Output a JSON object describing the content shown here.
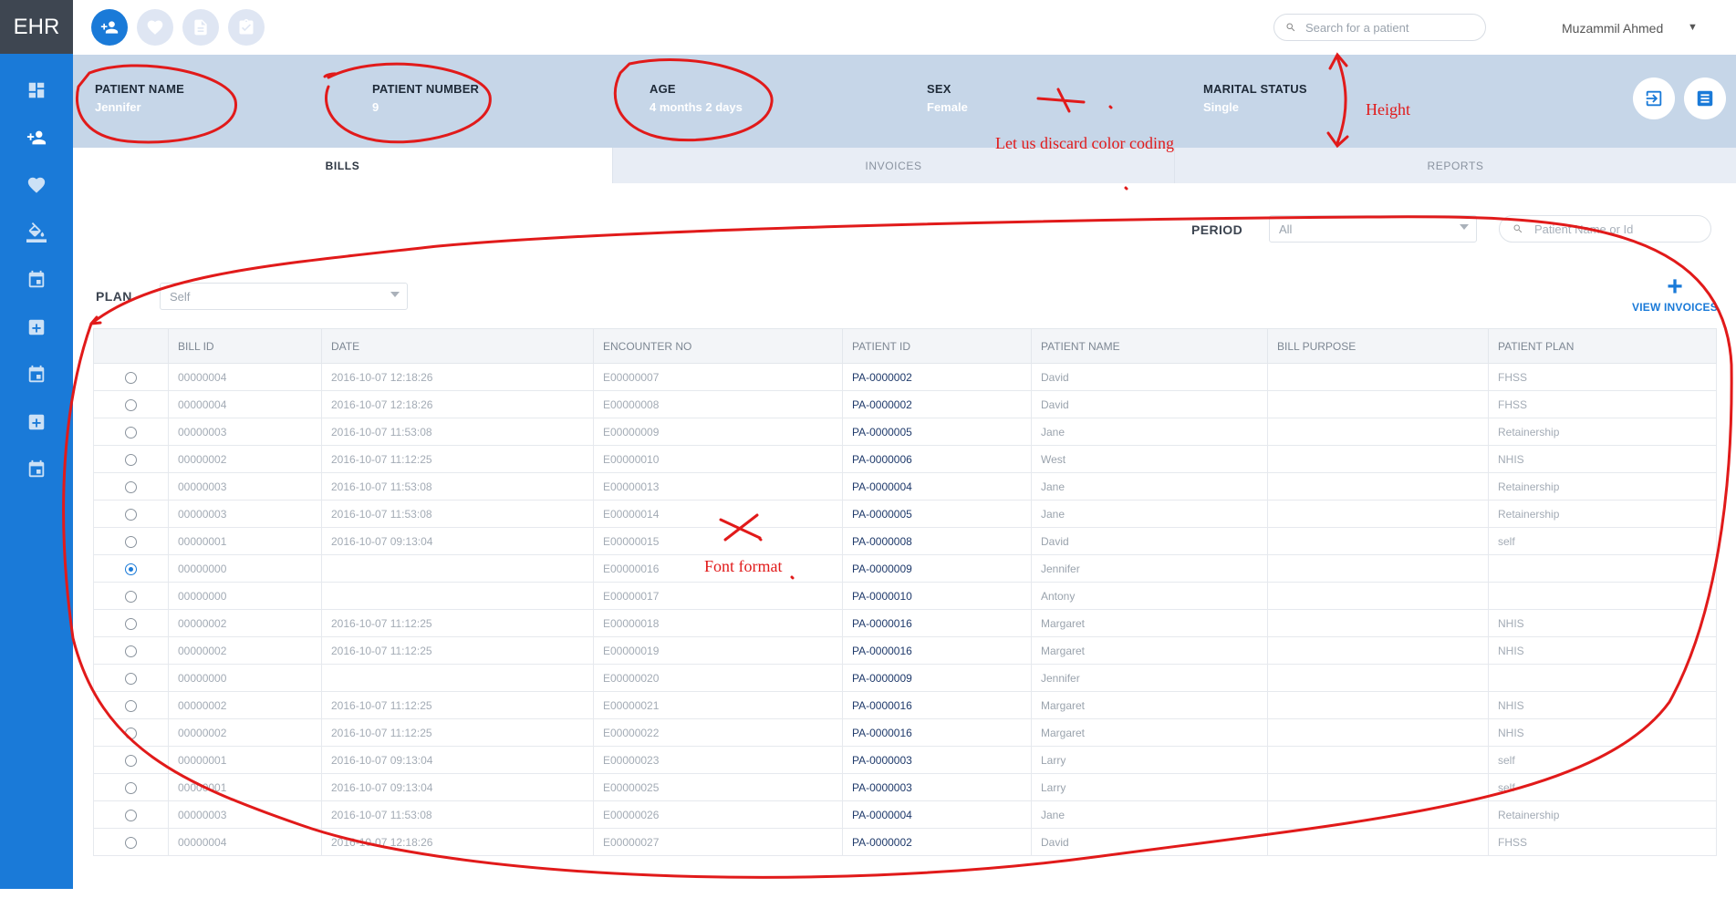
{
  "app": {
    "logo": "EHR"
  },
  "sidebar": {
    "icons": [
      {
        "name": "dashboard-icon",
        "active": false
      },
      {
        "name": "add-patient-icon",
        "active": true
      },
      {
        "name": "heart-icon",
        "active": false
      },
      {
        "name": "paint-bucket-icon",
        "active": false
      },
      {
        "name": "calendar-icon",
        "active": false
      },
      {
        "name": "hospital-add-icon",
        "active": false
      },
      {
        "name": "calendar-icon",
        "active": false
      },
      {
        "name": "hospital-add-icon",
        "active": false
      },
      {
        "name": "calendar-icon",
        "active": false
      }
    ]
  },
  "topbar": {
    "search_placeholder": "Search for a patient",
    "user_name": "Muzammil Ahmed"
  },
  "patient": {
    "name_label": "PATIENT NAME",
    "name": "Jennifer",
    "number_label": "PATIENT NUMBER",
    "number": "9",
    "age_label": "AGE",
    "age": "4 months 2 days",
    "sex_label": "SEX",
    "sex": "Female",
    "marital_label": "MARITAL STATUS",
    "marital": "Single"
  },
  "tabs": [
    {
      "label": "BILLS",
      "active": true
    },
    {
      "label": "INVOICES",
      "active": false
    },
    {
      "label": "REPORTS",
      "active": false
    }
  ],
  "filters": {
    "period_label": "PERIOD",
    "period_value": "All",
    "patient_search_placeholder": "Patient Name or Id",
    "plan_label": "PLAN",
    "plan_value": "Self",
    "view_invoices_label": "VIEW INVOICES",
    "add_symbol": "+"
  },
  "table": {
    "columns": [
      "BILL ID",
      "DATE",
      "ENCOUNTER NO",
      "PATIENT ID",
      "PATIENT NAME",
      "BILL PURPOSE",
      "PATIENT PLAN"
    ],
    "rows": [
      {
        "bill_id": "00000004",
        "date": "2016-10-07 12:18:26",
        "encounter": "E00000007",
        "patient_id": "PA-0000002",
        "patient_name": "David",
        "purpose": "",
        "plan": "FHSS",
        "selected": false
      },
      {
        "bill_id": "00000004",
        "date": "2016-10-07 12:18:26",
        "encounter": "E00000008",
        "patient_id": "PA-0000002",
        "patient_name": "David",
        "purpose": "",
        "plan": "FHSS",
        "selected": false
      },
      {
        "bill_id": "00000003",
        "date": "2016-10-07 11:53:08",
        "encounter": "E00000009",
        "patient_id": "PA-0000005",
        "patient_name": "Jane",
        "purpose": "",
        "plan": "Retainership",
        "selected": false
      },
      {
        "bill_id": "00000002",
        "date": "2016-10-07 11:12:25",
        "encounter": "E00000010",
        "patient_id": "PA-0000006",
        "patient_name": "West",
        "purpose": "",
        "plan": "NHIS",
        "selected": false
      },
      {
        "bill_id": "00000003",
        "date": "2016-10-07 11:53:08",
        "encounter": "E00000013",
        "patient_id": "PA-0000004",
        "patient_name": "Jane",
        "purpose": "",
        "plan": "Retainership",
        "selected": false
      },
      {
        "bill_id": "00000003",
        "date": "2016-10-07 11:53:08",
        "encounter": "E00000014",
        "patient_id": "PA-0000005",
        "patient_name": "Jane",
        "purpose": "",
        "plan": "Retainership",
        "selected": false
      },
      {
        "bill_id": "00000001",
        "date": "2016-10-07 09:13:04",
        "encounter": "E00000015",
        "patient_id": "PA-0000008",
        "patient_name": "David",
        "purpose": "",
        "plan": "self",
        "selected": false
      },
      {
        "bill_id": "00000000",
        "date": "",
        "encounter": "E00000016",
        "patient_id": "PA-0000009",
        "patient_name": "Jennifer",
        "purpose": "",
        "plan": "",
        "selected": true
      },
      {
        "bill_id": "00000000",
        "date": "",
        "encounter": "E00000017",
        "patient_id": "PA-0000010",
        "patient_name": "Antony",
        "purpose": "",
        "plan": "",
        "selected": false
      },
      {
        "bill_id": "00000002",
        "date": "2016-10-07 11:12:25",
        "encounter": "E00000018",
        "patient_id": "PA-0000016",
        "patient_name": "Margaret",
        "purpose": "",
        "plan": "NHIS",
        "selected": false
      },
      {
        "bill_id": "00000002",
        "date": "2016-10-07 11:12:25",
        "encounter": "E00000019",
        "patient_id": "PA-0000016",
        "patient_name": "Margaret",
        "purpose": "",
        "plan": "NHIS",
        "selected": false
      },
      {
        "bill_id": "00000000",
        "date": "",
        "encounter": "E00000020",
        "patient_id": "PA-0000009",
        "patient_name": "Jennifer",
        "purpose": "",
        "plan": "",
        "selected": false
      },
      {
        "bill_id": "00000002",
        "date": "2016-10-07 11:12:25",
        "encounter": "E00000021",
        "patient_id": "PA-0000016",
        "patient_name": "Margaret",
        "purpose": "",
        "plan": "NHIS",
        "selected": false
      },
      {
        "bill_id": "00000002",
        "date": "2016-10-07 11:12:25",
        "encounter": "E00000022",
        "patient_id": "PA-0000016",
        "patient_name": "Margaret",
        "purpose": "",
        "plan": "NHIS",
        "selected": false
      },
      {
        "bill_id": "00000001",
        "date": "2016-10-07 09:13:04",
        "encounter": "E00000023",
        "patient_id": "PA-0000003",
        "patient_name": "Larry",
        "purpose": "",
        "plan": "self",
        "selected": false
      },
      {
        "bill_id": "00000001",
        "date": "2016-10-07 09:13:04",
        "encounter": "E00000025",
        "patient_id": "PA-0000003",
        "patient_name": "Larry",
        "purpose": "",
        "plan": "self",
        "selected": false
      },
      {
        "bill_id": "00000003",
        "date": "2016-10-07 11:53:08",
        "encounter": "E00000026",
        "patient_id": "PA-0000004",
        "patient_name": "Jane",
        "purpose": "",
        "plan": "Retainership",
        "selected": false
      },
      {
        "bill_id": "00000004",
        "date": "2016-10-07 12:18:26",
        "encounter": "E00000027",
        "patient_id": "PA-0000002",
        "patient_name": "David",
        "purpose": "",
        "plan": "FHSS",
        "selected": false
      }
    ]
  },
  "annotations": {
    "color": "#e11a1a",
    "height_note": "Height",
    "color_note": "Let us discard color coding",
    "font_note": "Font format"
  }
}
